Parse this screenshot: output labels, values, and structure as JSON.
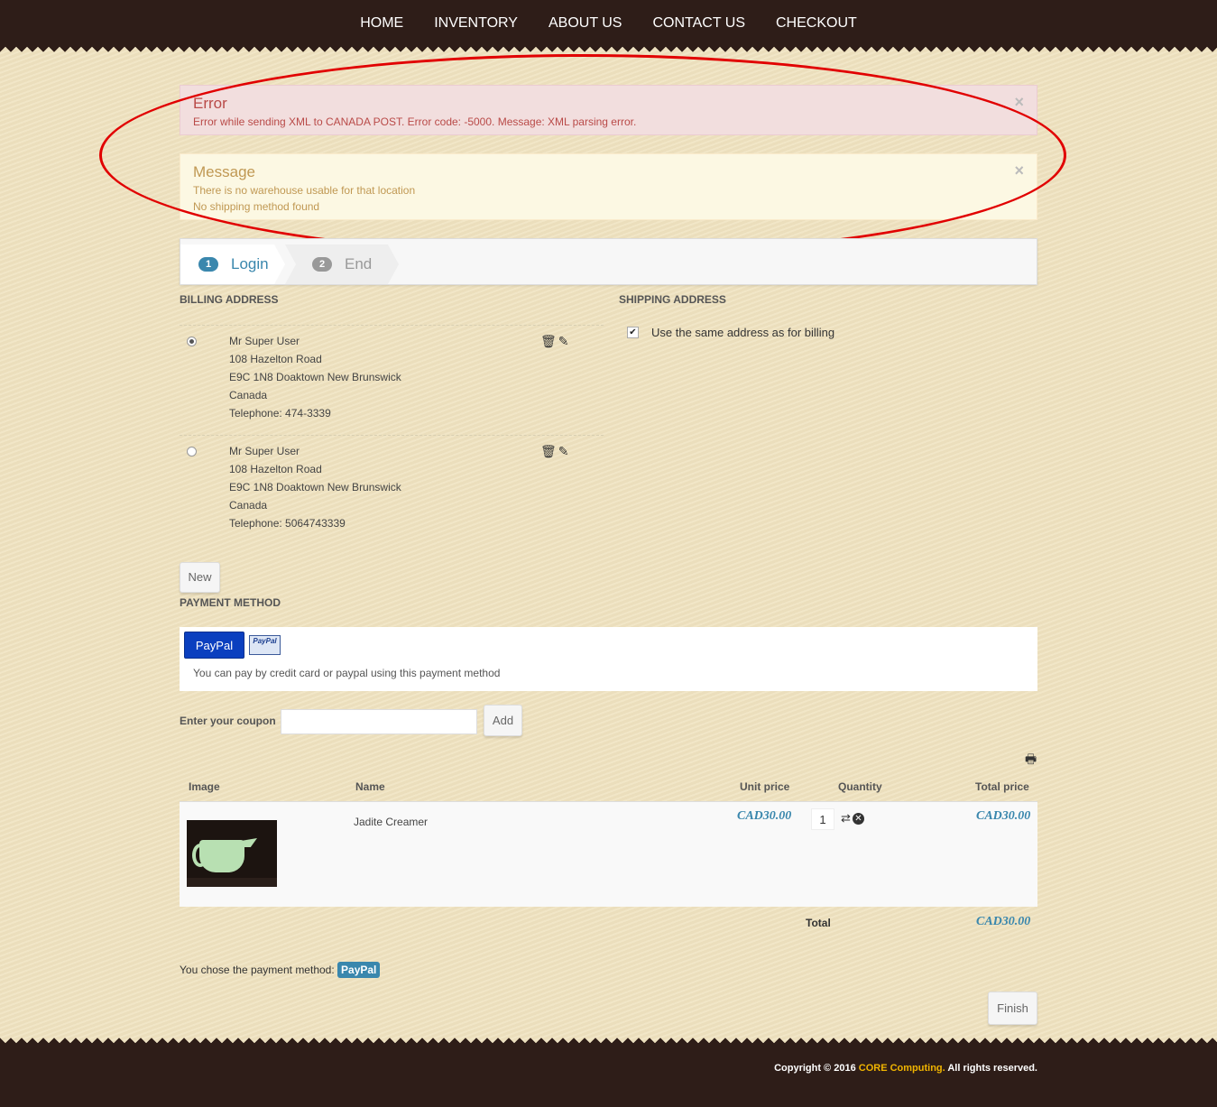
{
  "nav": [
    "HOME",
    "INVENTORY",
    "ABOUT US",
    "CONTACT US",
    "CHECKOUT"
  ],
  "alerts": {
    "error": {
      "title": "Error",
      "text": "Error while sending XML to CANADA POST. Error code: -5000. Message: XML parsing error.",
      "close": "×"
    },
    "message": {
      "title": "Message",
      "lines": [
        "There is no warehouse usable for that location",
        "No shipping method found"
      ],
      "close": "×"
    }
  },
  "steps": [
    {
      "num": "1",
      "label": "Login"
    },
    {
      "num": "2",
      "label": "End"
    }
  ],
  "billing": {
    "title": "BILLING ADDRESS",
    "addresses": [
      {
        "selected": true,
        "lines": [
          "Mr Super User",
          "108 Hazelton Road",
          "E9C 1N8 Doaktown New Brunswick",
          "Canada",
          "Telephone: 474-3339"
        ]
      },
      {
        "selected": false,
        "lines": [
          "Mr Super User",
          "108 Hazelton Road",
          "E9C 1N8 Doaktown New Brunswick",
          "Canada",
          "Telephone: 5064743339"
        ]
      }
    ],
    "new_button": "New"
  },
  "shipping": {
    "title": "SHIPPING ADDRESS",
    "same_as_billing_label": "Use the same address as for billing",
    "same_as_billing_checked": true
  },
  "payment": {
    "title": "PAYMENT METHOD",
    "button_label": "PayPal",
    "logo_text": "PayPal",
    "description": "You can pay by credit card or paypal using this payment method"
  },
  "coupon": {
    "label": "Enter your coupon",
    "value": "",
    "add_button": "Add"
  },
  "cart": {
    "columns": [
      "Image",
      "Name",
      "Unit price",
      "Quantity",
      "Total price"
    ],
    "items": [
      {
        "name": "Jadite Creamer",
        "unit_price": "CAD30.00",
        "quantity": "1",
        "total_price": "CAD30.00"
      }
    ],
    "total_label": "Total",
    "total_value": "CAD30.00"
  },
  "chosen_payment": {
    "prefix": "You chose the payment method:",
    "method": "PayPal"
  },
  "finish_button": "Finish",
  "footer": {
    "prefix": "Copyright © 2016 ",
    "brand": "CORE Computing.",
    "suffix": " All rights reserved."
  },
  "colors": {
    "accent": "#3a87ad",
    "header_bg": "#2e1d18",
    "error_bg": "#f2dede",
    "warning_bg": "#fcf8e3",
    "annotation_circle": "#e10000"
  }
}
